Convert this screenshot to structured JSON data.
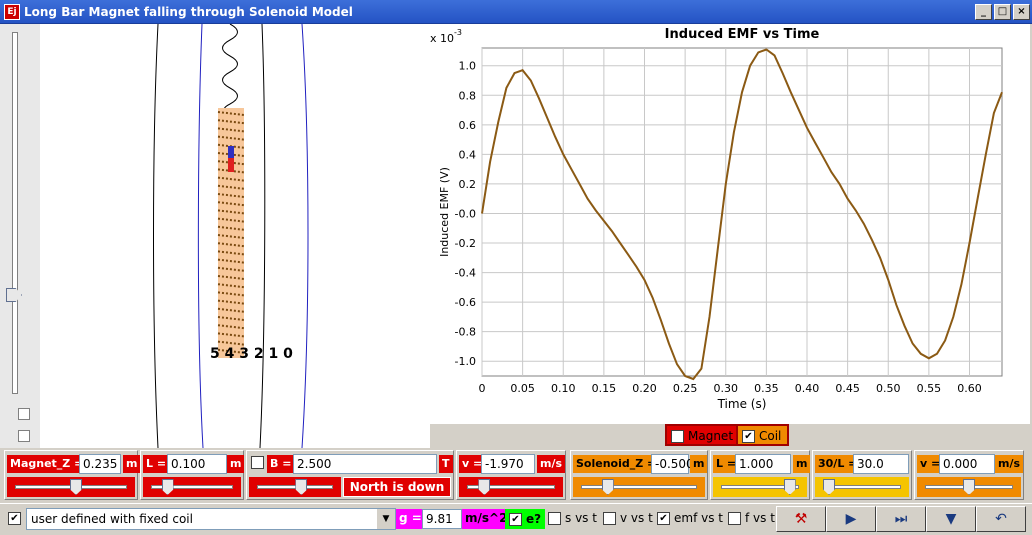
{
  "window": {
    "title": "Long Bar Magnet falling through Solenoid Model",
    "icon_text": "Ej",
    "min": "_",
    "max": "□",
    "close": "×"
  },
  "chart_data": {
    "type": "line",
    "title": "Induced EMF vs Time",
    "xlabel": "Time (s)",
    "ylabel": "Induced EMF (V)",
    "yscale_label": "x 10",
    "yscale_exp": "-3",
    "xlim": [
      0,
      0.64
    ],
    "ylim": [
      -1.1,
      1.12
    ],
    "xticks": [
      "0",
      "0.05",
      "0.10",
      "0.15",
      "0.20",
      "0.25",
      "0.30",
      "0.35",
      "0.40",
      "0.45",
      "0.50",
      "0.55",
      "0.60"
    ],
    "xtick_values": [
      0,
      0.05,
      0.1,
      0.15,
      0.2,
      0.25,
      0.3,
      0.35,
      0.4,
      0.45,
      0.5,
      0.55,
      0.6
    ],
    "yticks": [
      "1.0",
      "0.8",
      "0.6",
      "0.4",
      "0.2",
      "-0.0",
      "-0.2",
      "-0.4",
      "-0.6",
      "-0.8",
      "-1.0"
    ],
    "ytick_values": [
      1.0,
      0.8,
      0.6,
      0.4,
      0.2,
      0.0,
      -0.2,
      -0.4,
      -0.6,
      -0.8,
      -1.0
    ],
    "grid": true,
    "color": "#8b5a14",
    "series": [
      {
        "x": [
          0,
          0.01,
          0.02,
          0.03,
          0.04,
          0.05,
          0.06,
          0.07,
          0.08,
          0.09,
          0.1,
          0.11,
          0.12,
          0.13,
          0.14,
          0.15,
          0.16,
          0.17,
          0.18,
          0.19,
          0.2,
          0.21,
          0.22,
          0.23,
          0.24,
          0.25,
          0.26,
          0.27,
          0.28,
          0.29,
          0.3,
          0.31,
          0.32,
          0.33,
          0.34,
          0.35,
          0.36,
          0.37,
          0.38,
          0.39,
          0.4,
          0.41,
          0.42,
          0.43,
          0.44,
          0.45,
          0.46,
          0.47,
          0.48,
          0.49,
          0.5,
          0.51,
          0.52,
          0.53,
          0.54,
          0.55,
          0.56,
          0.57,
          0.58,
          0.59,
          0.6,
          0.61,
          0.62,
          0.63,
          0.64
        ],
        "y": [
          0,
          0.35,
          0.62,
          0.85,
          0.95,
          0.97,
          0.9,
          0.78,
          0.65,
          0.52,
          0.4,
          0.3,
          0.2,
          0.1,
          0.02,
          -0.05,
          -0.12,
          -0.2,
          -0.28,
          -0.36,
          -0.45,
          -0.57,
          -0.72,
          -0.88,
          -1.02,
          -1.1,
          -1.12,
          -1.05,
          -0.7,
          -0.25,
          0.2,
          0.55,
          0.82,
          1.0,
          1.09,
          1.11,
          1.07,
          0.95,
          0.82,
          0.7,
          0.58,
          0.48,
          0.38,
          0.28,
          0.2,
          0.1,
          0.02,
          -0.07,
          -0.18,
          -0.3,
          -0.45,
          -0.62,
          -0.76,
          -0.88,
          -0.95,
          -0.98,
          -0.95,
          -0.86,
          -0.7,
          -0.48,
          -0.2,
          0.1,
          0.4,
          0.68,
          0.82
        ]
      }
    ]
  },
  "sim": {
    "pole_labels": "5 4 3 2 1 0"
  },
  "legend": {
    "magnet": "Magnet",
    "coil": "Coil",
    "magnet_checked": "",
    "coil_checked": "✔"
  },
  "params": {
    "magnet_z": {
      "label": "Magnet_Z =",
      "value": "0.235",
      "unit": "m",
      "slider": 0.55
    },
    "magnet_l": {
      "label": "L =",
      "value": "0.100",
      "unit": "m",
      "slider": 0.15
    },
    "b": {
      "label": "B =",
      "value": "2.500",
      "unit": "T",
      "slider": 0.6,
      "north_label": "North is down"
    },
    "v": {
      "label": "v =",
      "value": "-1.970",
      "unit": "m/s",
      "slider": 0.15
    },
    "solenoid_z": {
      "label": "Solenoid_Z =",
      "value": "-0.500",
      "unit": "m",
      "slider": 0.2
    },
    "solenoid_l": {
      "label": "L =",
      "value": "1.000",
      "unit": "m",
      "slider": 0.95
    },
    "turns": {
      "label": "30/L =",
      "value": "30.0",
      "slider": 0.0
    },
    "v2": {
      "label": "v =",
      "value": "0.000",
      "unit": "m/s",
      "slider": 0.5
    }
  },
  "bottom": {
    "mode_checked": "✔",
    "mode": "user defined with fixed coil",
    "g_label": "g =",
    "g_value": "9.81",
    "g_unit": "m/s^2",
    "e_label": "e?",
    "e_checked": "✔",
    "opts": [
      {
        "label": "s vs t",
        "checked": ""
      },
      {
        "label": "v vs t",
        "checked": ""
      },
      {
        "label": "emf vs t",
        "checked": "✔"
      },
      {
        "label": "f vs t",
        "checked": ""
      }
    ],
    "buttons": [
      "hammer-icon",
      "play-icon",
      "step-icon",
      "down-icon",
      "reset-icon"
    ]
  }
}
